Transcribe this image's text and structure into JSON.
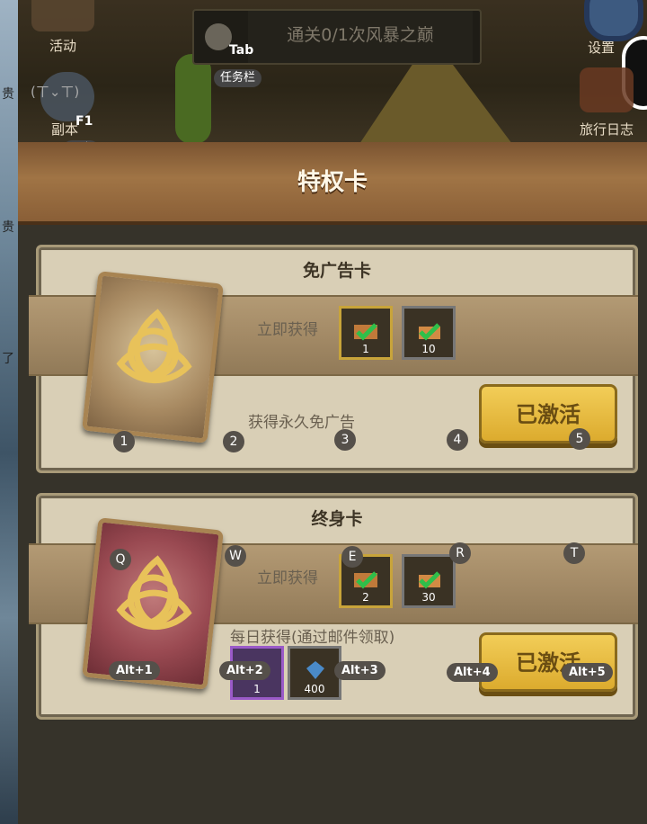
{
  "left_strip": {
    "chars": [
      "贵",
      "贵",
      "了"
    ]
  },
  "top_bar": {
    "activity_label": "活动",
    "quest_text": "通关0/1次风暴之巅",
    "tab_key": "Tab",
    "tab_label": "任务栏",
    "settings_label": "设置",
    "dungeon_key": "F1",
    "dungeon_hint": "副本",
    "dungeon_label": "副本",
    "journal_label": "旅行日志",
    "partial_text": "(ㄒ⌄ㄒ)"
  },
  "title": "特权卡",
  "cards": [
    {
      "name": "免广告卡",
      "instant_label": "立即获得",
      "items": [
        {
          "count": "1",
          "frame": "gold"
        },
        {
          "count": "10",
          "frame": "gray"
        }
      ],
      "desc": "获得永久免广告",
      "button": "已激活",
      "hotkeys": [
        "1",
        "2",
        "3",
        "4",
        "5"
      ]
    },
    {
      "name": "终身卡",
      "instant_label": "立即获得",
      "items": [
        {
          "count": "2",
          "frame": "gold"
        },
        {
          "count": "30",
          "frame": "gray"
        }
      ],
      "daily_label": "每日获得(通过邮件领取)",
      "daily_items": [
        {
          "count": "1",
          "frame": "purple"
        },
        {
          "count": "400",
          "frame": "gray"
        }
      ],
      "button": "已激活",
      "hotkeys": [
        "Q",
        "W",
        "E",
        "R",
        "T"
      ],
      "alt_hotkeys": [
        "Alt+1",
        "Alt+2",
        "Alt+3",
        "Alt+4",
        "Alt+5"
      ]
    }
  ],
  "colors": {
    "button_gold": "#e8bd44",
    "panel": "#d9cfb6",
    "banner": "#a07445"
  }
}
